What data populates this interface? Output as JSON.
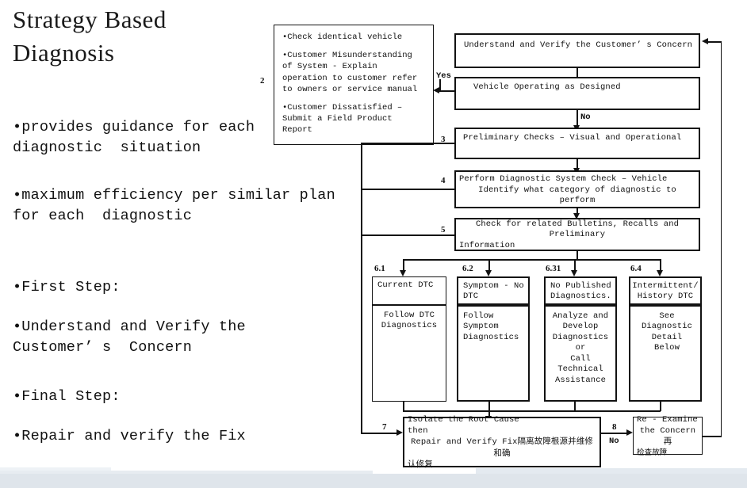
{
  "slide": {
    "title": "Strategy Based\nDiagnosis",
    "bullets": [
      "•provides guidance for each\ndiagnostic  situation",
      "•maximum efficiency per similar plan\nfor each  diagnostic",
      "•First Step:",
      "•Understand and Verify the\nCustomer’ s  Concern",
      "•Final Step:",
      "•Repair and verify the Fix"
    ]
  },
  "callout": {
    "number": "2",
    "items": [
      "•Check identical vehicle",
      "•Customer Misunderstanding of System - Explain operation to customer refer to owners or service manual",
      "•Customer Dissatisfied – Submit a Field Product Report"
    ]
  },
  "flow": {
    "step1": {
      "text": "Understand and Verify the Customer’ s Concern"
    },
    "step2": {
      "text": "Vehicle Operating as Designed"
    },
    "step3": {
      "number": "3",
      "text": "Preliminary Checks – Visual and Operational"
    },
    "step4": {
      "number": "4",
      "line1": "Perform Diagnostic System Check – Vehicle",
      "line2": "Identify what category of diagnostic to perform"
    },
    "step5": {
      "number": "5",
      "line1": "Check for related Bulletins, Recalls and Preliminary",
      "line2": "Information"
    },
    "branches": [
      {
        "number": "6.1",
        "head": "Current DTC",
        "body": "Follow DTC\nDiagnostics"
      },
      {
        "number": "6.2",
        "head": "Symptom  - No\nDTC",
        "body": "Follow Symptom\nDiagnostics"
      },
      {
        "number": "6.31",
        "head": "No Published\nDiagnostics.",
        "body": "Analyze and\nDevelop\nDiagnostics or\nCall Technical\nAssistance"
      },
      {
        "number": "6.4",
        "head": "Intermittent/\nHistory DTC",
        "body": "See Diagnostic\nDetail\nBelow"
      }
    ],
    "step7": {
      "number": "7",
      "line1": "Isolate the Root Cause",
      "line2": "then",
      "line3": "Repair and Verify Fix",
      "line3_cn": "隔离故障根源并维修和确",
      "line4_cn": "认修复"
    },
    "step8": {
      "number": "8",
      "line1": "Re  - Examine",
      "line2": "the Concern",
      "line2_cn": "再",
      "line3_cn": "检查故障"
    },
    "labels": {
      "yes": "Yes",
      "no_step2": "No",
      "no_step8": "No"
    }
  },
  "colors": {
    "ink": "#121212",
    "paper": "#ffffff",
    "band": "#dfe5eb"
  }
}
